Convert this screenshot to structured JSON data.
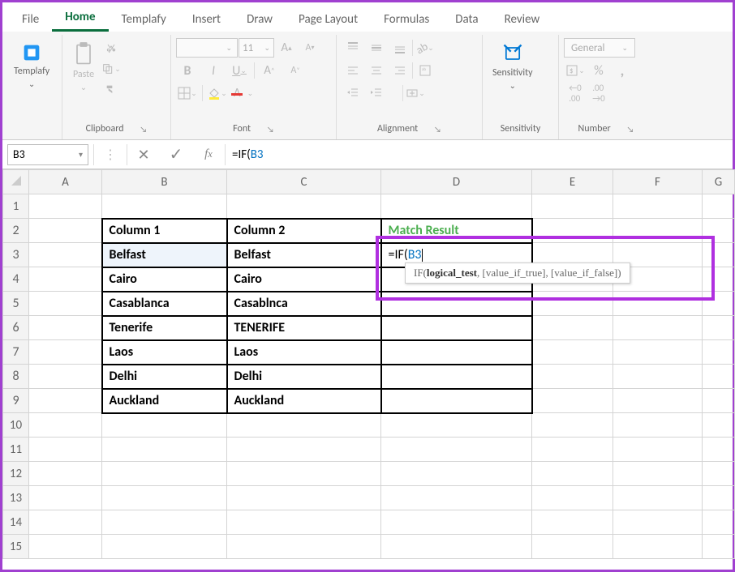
{
  "ribbon": {
    "tabs": [
      "File",
      "Home",
      "Templafy",
      "Insert",
      "Draw",
      "Page Layout",
      "Formulas",
      "Data",
      "Review"
    ],
    "activeTab": "Home",
    "templafy": "Templafy",
    "paste": "Paste",
    "sensitivity": "Sensitivity",
    "font_name": "",
    "font_size": "11",
    "number_format": "General",
    "group_clipboard": "Clipboard",
    "group_font": "Font",
    "group_alignment": "Alignment",
    "group_sensitivity": "Sensitivity",
    "group_number": "Number"
  },
  "formula_bar": {
    "name_box": "B3",
    "formula_prefix": "=IF(",
    "formula_ref": "B3"
  },
  "tooltip": {
    "fn": "IF(",
    "arg1": "logical_test",
    "rest": ", [value_if_true], [value_if_false])"
  },
  "columns": [
    "A",
    "B",
    "C",
    "D",
    "E",
    "F",
    "G"
  ],
  "rows": [
    "1",
    "2",
    "3",
    "4",
    "5",
    "6",
    "7",
    "8",
    "9",
    "10",
    "11",
    "12",
    "13",
    "14",
    "15"
  ],
  "table": {
    "headers": {
      "col1": "Column 1",
      "col2": "Column 2",
      "match": "Match Result"
    },
    "data": [
      {
        "c1": "Belfast",
        "c2": "Belfast"
      },
      {
        "c1": "Cairo",
        "c2": "Cairo"
      },
      {
        "c1": "Casablanca",
        "c2": "Casablnca"
      },
      {
        "c1": "Tenerife",
        "c2": "TENERIFE"
      },
      {
        "c1": "Laos",
        "c2": "Laos"
      },
      {
        "c1": "Delhi",
        "c2": "Delhi"
      },
      {
        "c1": "Auckland",
        "c2": "Auckland"
      }
    ],
    "editing_prefix": "=IF(",
    "editing_ref": "B3"
  }
}
